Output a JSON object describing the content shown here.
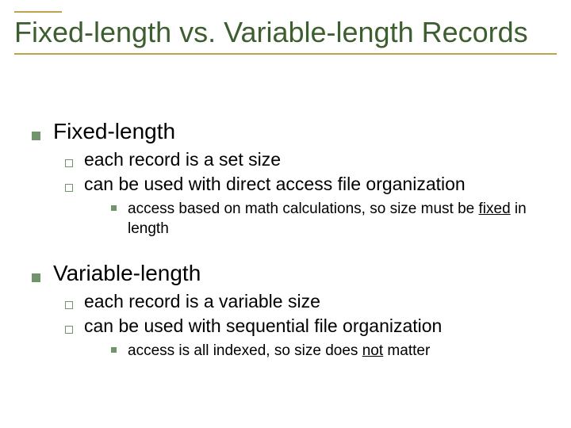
{
  "title": "Fixed-length vs. Variable-length Records",
  "sections": [
    {
      "heading": "Fixed-length",
      "points": [
        "each record is a set size",
        "can be used with direct access file organization"
      ],
      "subpoint_prefix": "access based on math calculations, so size must be ",
      "subpoint_underlined": "fixed",
      "subpoint_suffix": " in length"
    },
    {
      "heading": "Variable-length",
      "points": [
        "each record is a variable size",
        "can be used with sequential file organization"
      ],
      "subpoint_prefix": "access is all indexed, so size does ",
      "subpoint_underlined": "not",
      "subpoint_suffix": " matter"
    }
  ]
}
